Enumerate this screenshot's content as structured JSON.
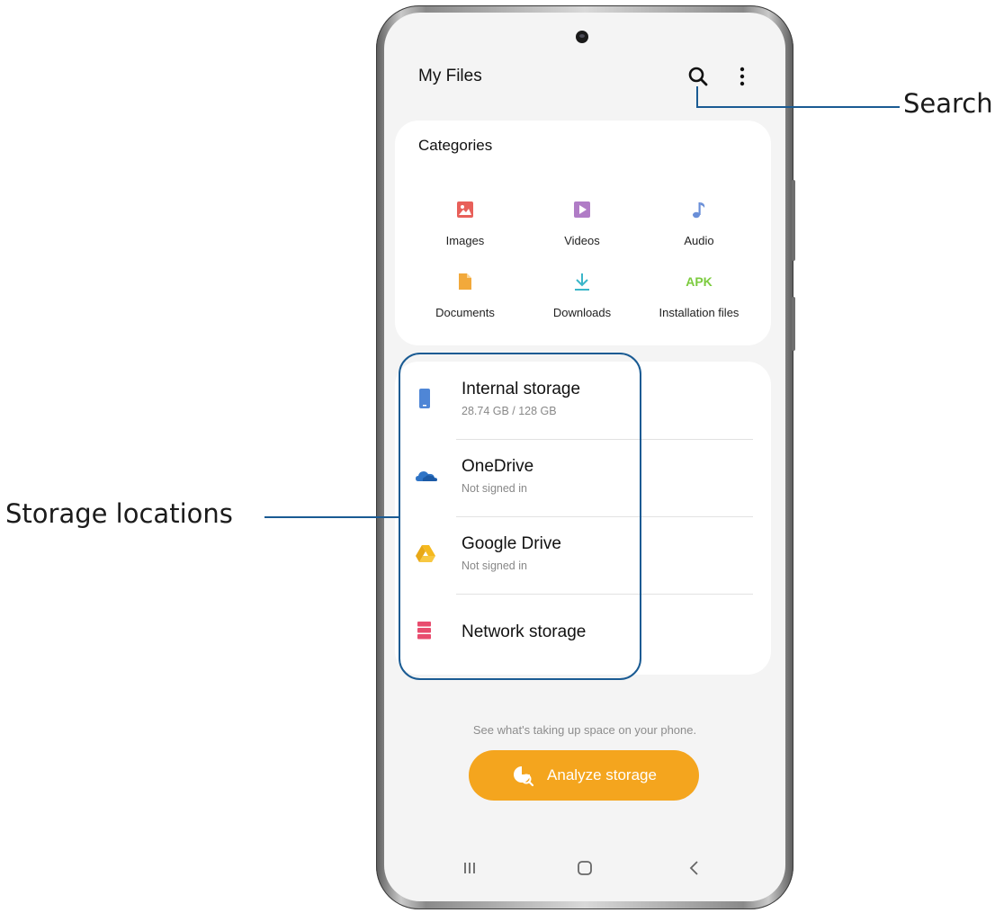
{
  "app": {
    "title": "My Files"
  },
  "toolbar": {
    "search_icon": "search-icon",
    "more_icon": "more-options-icon"
  },
  "categories": {
    "heading": "Categories",
    "items": [
      {
        "label": "Images",
        "icon": "image-icon",
        "color": "#e8605a"
      },
      {
        "label": "Videos",
        "icon": "video-icon",
        "color": "#b07cc6"
      },
      {
        "label": "Audio",
        "icon": "music-note-icon",
        "color": "#6a8fd8"
      },
      {
        "label": "Documents",
        "icon": "document-icon",
        "color": "#f2a93b"
      },
      {
        "label": "Downloads",
        "icon": "download-icon",
        "color": "#3bb6c9"
      },
      {
        "label": "Installation files",
        "icon": "apk-icon",
        "icon_text": "APK",
        "color": "#7ccb3f"
      }
    ]
  },
  "storage": {
    "items": [
      {
        "name": "Internal storage",
        "detail": "28.74 GB / 128 GB",
        "icon": "phone-icon",
        "color": "#4f86d6"
      },
      {
        "name": "OneDrive",
        "detail": "Not signed in",
        "icon": "cloud-icon",
        "color": "#2f74c6"
      },
      {
        "name": "Google Drive",
        "detail": "Not signed in",
        "icon": "drive-icon",
        "color": "#f5b91e"
      },
      {
        "name": "Network storage",
        "detail": "",
        "icon": "server-icon",
        "color": "#e84c6e"
      }
    ]
  },
  "analyze": {
    "hint": "See what's taking up space on your phone.",
    "button_label": "Analyze storage",
    "button_color": "#f4a51e"
  },
  "navbar": {
    "recents": "recents-icon",
    "home": "home-icon",
    "back": "back-icon"
  },
  "callouts": {
    "search": "Search",
    "storage": "Storage locations",
    "line_color": "#1a5b93"
  }
}
